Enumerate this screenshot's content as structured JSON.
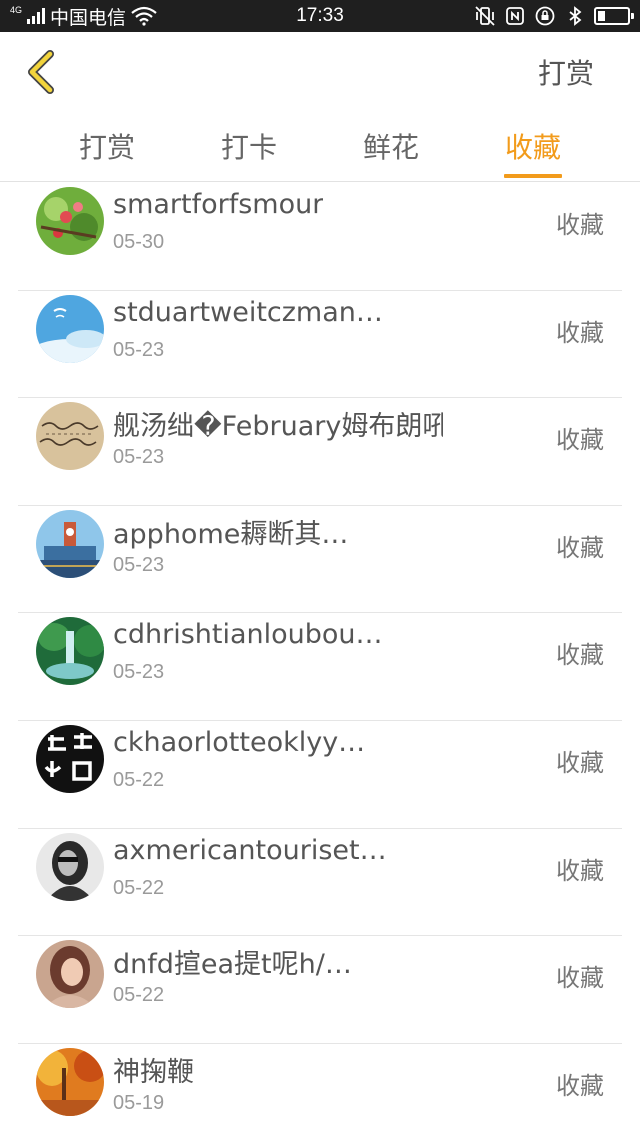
{
  "status_bar": {
    "network": "4G",
    "carrier": "中国电信",
    "time": "17:33",
    "battery_level": 0.25,
    "icons": [
      "signal-icon",
      "wifi-icon",
      "vibrate-icon",
      "nfc-icon",
      "rotation-lock-icon",
      "bluetooth-icon",
      "battery-icon"
    ]
  },
  "header": {
    "back_icon": "chevron-left-icon",
    "action_label": "打赏",
    "accent_color": "#f29b1b",
    "back_icon_color": "#f2d43c"
  },
  "tabs": [
    {
      "label": "打赏",
      "active": false
    },
    {
      "label": "打卡",
      "active": false
    },
    {
      "label": "鲜花",
      "active": false
    },
    {
      "label": "收藏",
      "active": true
    }
  ],
  "list": {
    "items": [
      {
        "name": "smartforfsmour",
        "date": "05-30",
        "action": "收藏",
        "avatar": "flowers-photo"
      },
      {
        "name": "stduartweitczman…",
        "date": "05-23",
        "action": "收藏",
        "avatar": "sky-photo"
      },
      {
        "name": "舰汤绌�February姆布朗吼",
        "date": "05-23",
        "action": "收藏",
        "avatar": "handwriting-photo"
      },
      {
        "name": "apphome耨断其…",
        "date": "05-23",
        "action": "收藏",
        "avatar": "clocktower-photo"
      },
      {
        "name": "cdhrishtianloubou…",
        "date": "05-23",
        "action": "收藏",
        "avatar": "waterfall-photo"
      },
      {
        "name": "ckhaorlotteoklyy…",
        "date": "05-22",
        "action": "收藏",
        "avatar": "calligraphy-logo"
      },
      {
        "name": "axmericantouriset…",
        "date": "05-22",
        "action": "收藏",
        "avatar": "portrait-bw-photo"
      },
      {
        "name": "dnfd揎ea提t呢h/…",
        "date": "05-22",
        "action": "收藏",
        "avatar": "portrait-photo"
      },
      {
        "name": "神掬鞭",
        "date": "05-19",
        "action": "收藏",
        "avatar": "autumn-photo"
      }
    ]
  }
}
